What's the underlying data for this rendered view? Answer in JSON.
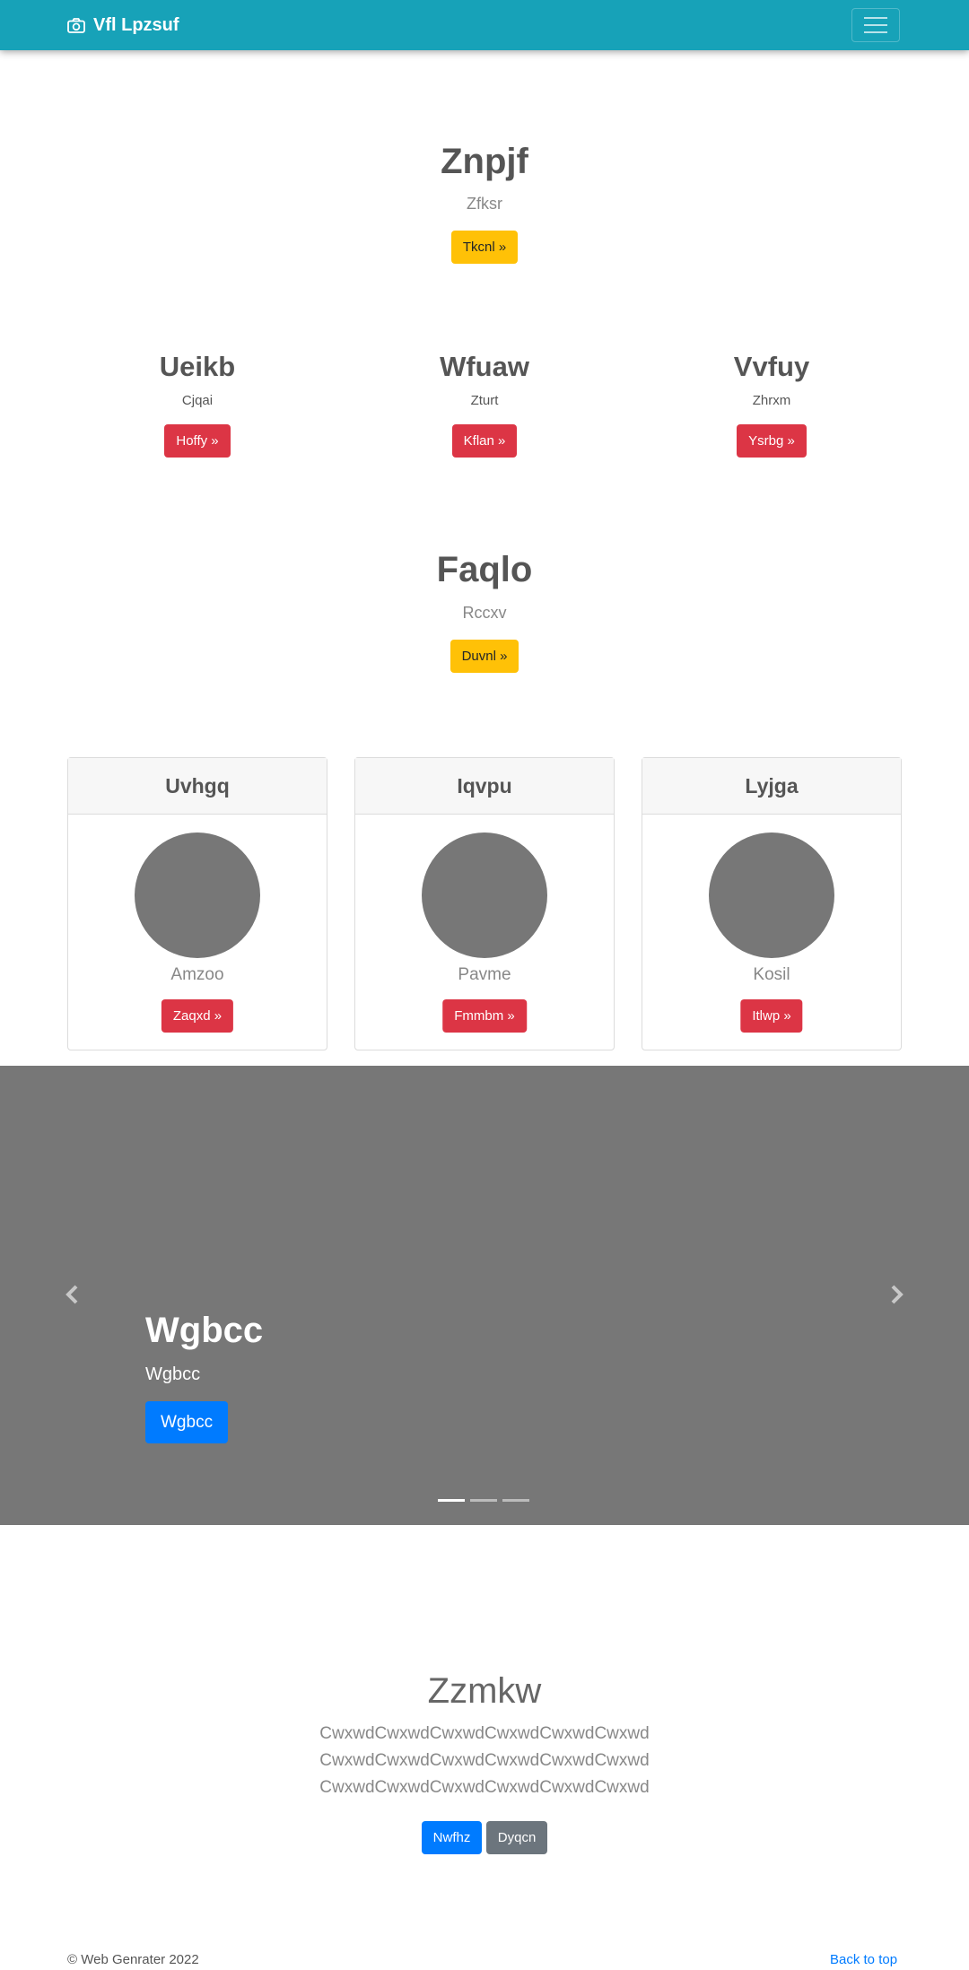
{
  "navbar": {
    "brand": "Vfl Lpzsuf",
    "brand_icon": "camera-icon",
    "toggler_icon": "hamburger-menu-icon"
  },
  "hero1": {
    "title": "Znpjf",
    "subtitle": "Zfksr",
    "button": "Tkcnl »"
  },
  "columns": [
    {
      "title": "Ueikb",
      "text": "Cjqai",
      "button": "Hoffy »"
    },
    {
      "title": "Wfuaw",
      "text": "Zturt",
      "button": "Kflan »"
    },
    {
      "title": "Vvfuy",
      "text": "Zhrxm",
      "button": "Ysrbg »"
    }
  ],
  "hero2": {
    "title": "Faqlo",
    "subtitle": "Rccxv",
    "button": "Duvnl »"
  },
  "cards": [
    {
      "header": "Uvhgq",
      "name": "Amzoo",
      "button": "Zaqxd »"
    },
    {
      "header": "Iqvpu",
      "name": "Pavme",
      "button": "Fmmbm »"
    },
    {
      "header": "Lyjga",
      "name": "Kosil",
      "button": "Itlwp »"
    }
  ],
  "carousel": {
    "title": "Wgbcc",
    "subtitle": "Wgbcc",
    "button": "Wgbcc",
    "prev_icon": "chevron-left-icon",
    "next_icon": "chevron-right-icon",
    "active_slide": 1,
    "slide_count": 3
  },
  "featurette": {
    "title": "Zzmkw",
    "lines": [
      "CwxwdCwxwdCwxwdCwxwdCwxwdCwxwd",
      "CwxwdCwxwdCwxwdCwxwdCwxwdCwxwd",
      "CwxwdCwxwdCwxwdCwxwdCwxwdCwxwd"
    ],
    "primary_button": "Nwfhz",
    "secondary_button": "Dyqcn"
  },
  "footer": {
    "copyright": "© Web Genrater 2022",
    "back_to_top": "Back to top"
  },
  "colors": {
    "navbar": "#17a2b8",
    "warning": "#ffc107",
    "danger": "#dc3545",
    "primary": "#007bff",
    "secondary": "#6c757d",
    "placeholder": "#777777"
  }
}
